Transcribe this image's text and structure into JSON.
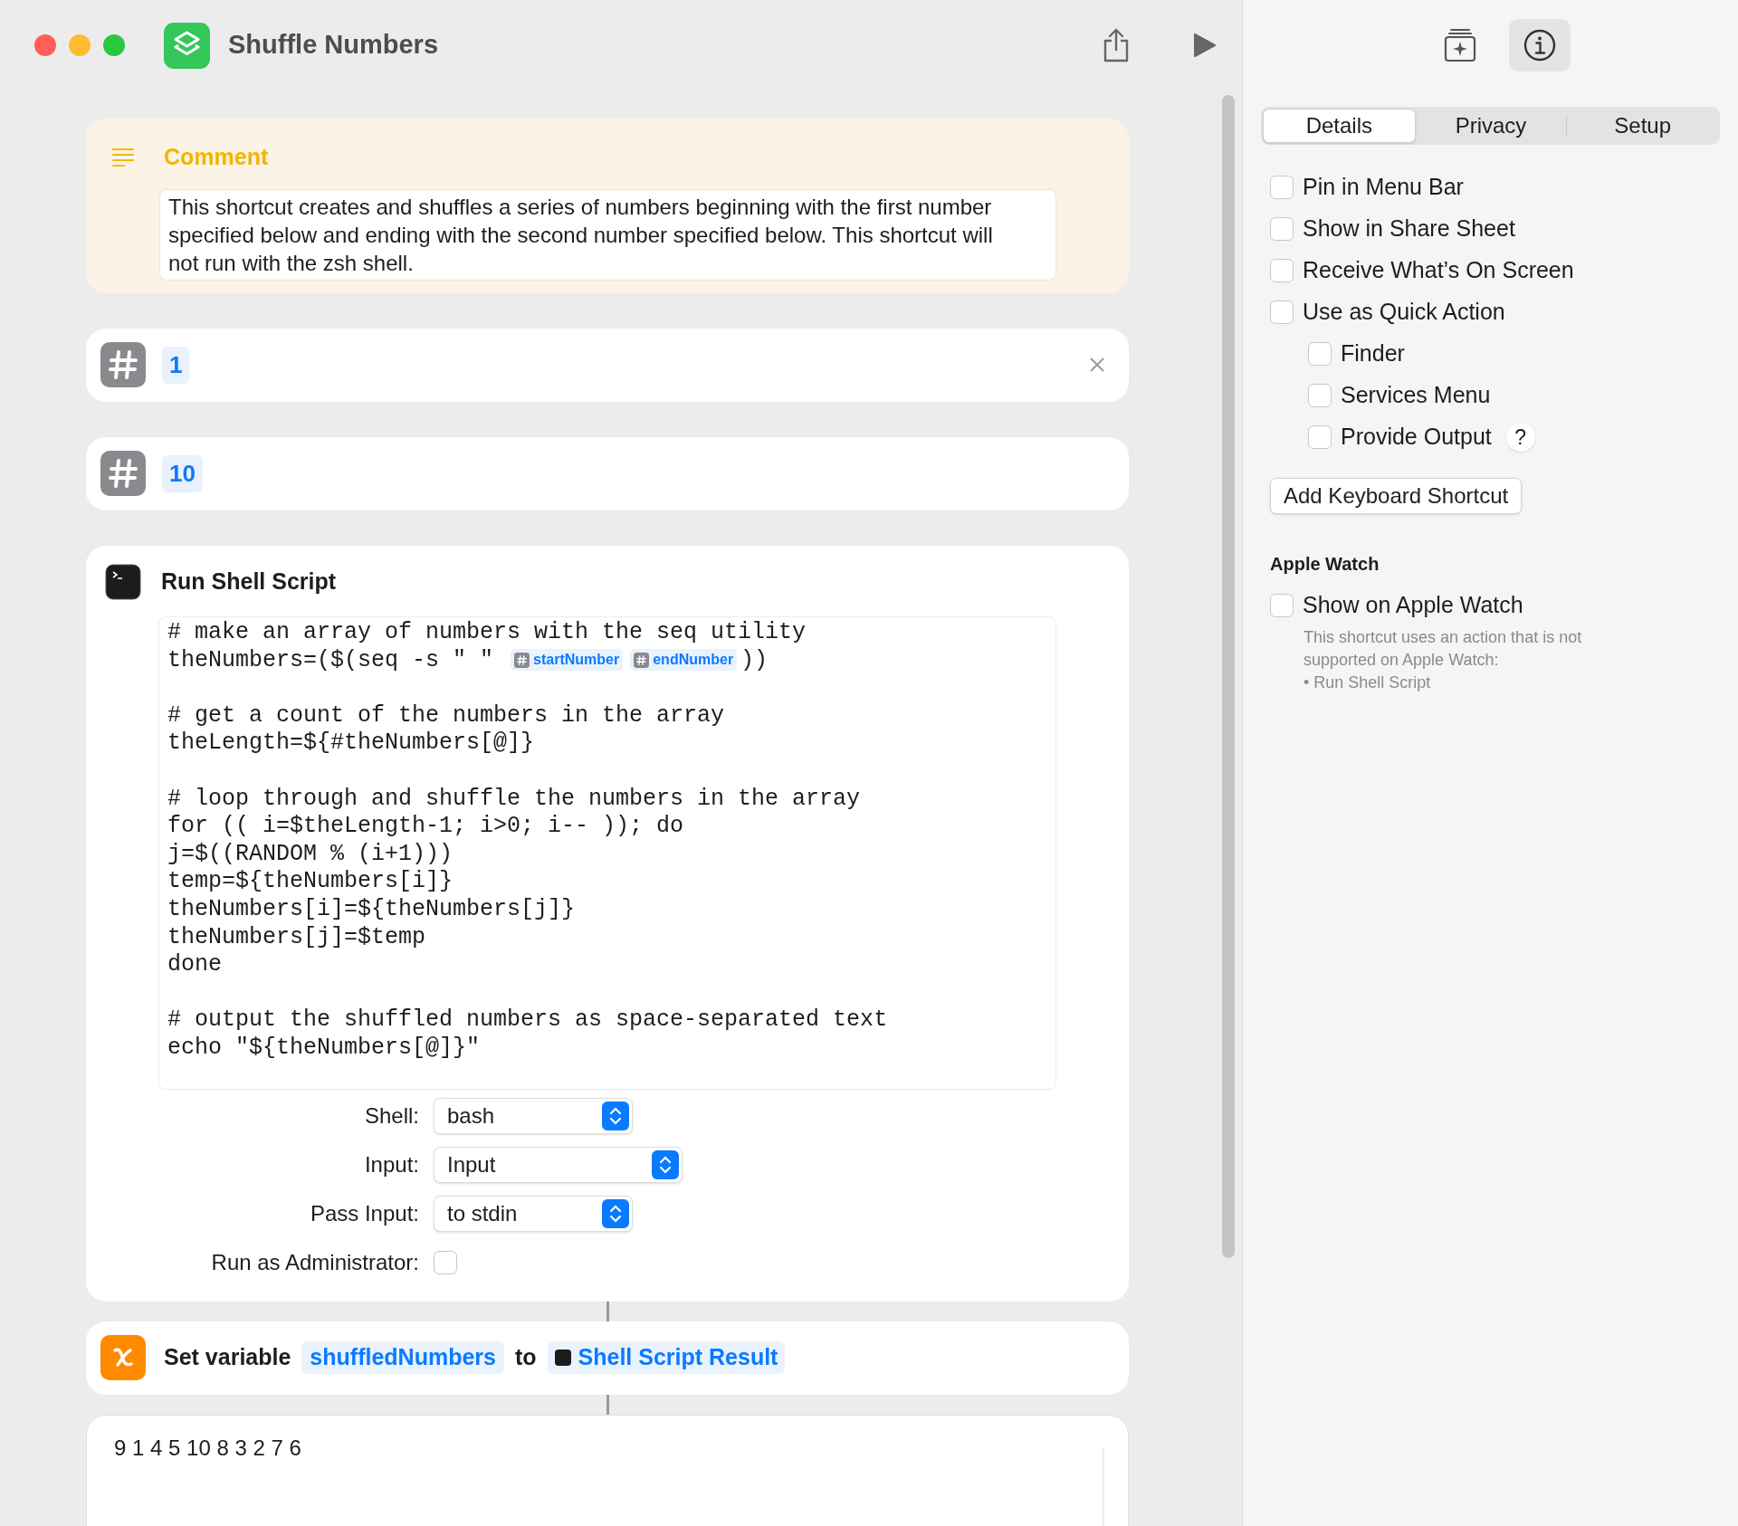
{
  "window": {
    "title": "Shuffle Numbers"
  },
  "actions": [
    {
      "kind": "comment",
      "title": "Comment",
      "text": "This shortcut creates and shuffles a series of numbers beginning with the first number specified below and ending with the second number specified below. This shortcut will not run with the zsh shell."
    },
    {
      "kind": "number",
      "value": "1",
      "removable": true
    },
    {
      "kind": "number",
      "value": "10",
      "removable": false
    },
    {
      "kind": "shell",
      "title": "Run Shell Script",
      "code_blocks": [
        [
          [
            {
              "kind": "text",
              "text": "# make an array of numbers with the seq utility"
            }
          ],
          [
            {
              "kind": "text",
              "text": "theNumbers=($(seq -s \" \" "
            },
            {
              "kind": "token",
              "text": "startNumber"
            },
            {
              "kind": "token",
              "text": "endNumber"
            },
            {
              "kind": "text",
              "text": "))"
            }
          ]
        ],
        [
          [
            {
              "kind": "text",
              "text": "# get a count of the numbers in the array"
            }
          ],
          [
            {
              "kind": "text",
              "text": "theLength=${#theNumbers[@]}"
            }
          ]
        ],
        [
          [
            {
              "kind": "text",
              "text": "# loop through and shuffle the numbers in the array"
            }
          ],
          [
            {
              "kind": "text",
              "text": "for (( i=$theLength-1; i>0; i-- )); do"
            }
          ],
          [
            {
              "kind": "text",
              "text": "j=$((RANDOM % (i+1)))"
            }
          ],
          [
            {
              "kind": "text",
              "text": "temp=${theNumbers[i]}"
            }
          ],
          [
            {
              "kind": "text",
              "text": "theNumbers[i]=${theNumbers[j]}"
            }
          ],
          [
            {
              "kind": "text",
              "text": "theNumbers[j]=$temp"
            }
          ],
          [
            {
              "kind": "text",
              "text": "done"
            }
          ]
        ],
        [
          [
            {
              "kind": "text",
              "text": "# output the shuffled numbers as space-separated text"
            }
          ],
          [
            {
              "kind": "text",
              "text": "echo \"${theNumbers[@]}\""
            }
          ]
        ]
      ],
      "options": [
        {
          "kind": "popup",
          "label": "Shell:",
          "value": "bash"
        },
        {
          "kind": "popup",
          "label": "Input:",
          "value": "Input"
        },
        {
          "kind": "popup",
          "label": "Pass Input:",
          "value": "to stdin"
        },
        {
          "kind": "checkbox",
          "label": "Run as Administrator:",
          "checked": false
        }
      ]
    },
    {
      "kind": "set_variable",
      "parts": [
        {
          "kind": "text",
          "text": "Set variable"
        },
        {
          "kind": "variable",
          "text": "shuffledNumbers"
        },
        {
          "kind": "text",
          "text": "to"
        },
        {
          "kind": "result",
          "text": "Shell Script Result"
        }
      ]
    },
    {
      "kind": "output",
      "text": "9 1 4 5 10 8 3 2 7 6"
    }
  ],
  "inspector": {
    "tabs": [
      {
        "label": "Details",
        "selected": true
      },
      {
        "label": "Privacy",
        "selected": false
      },
      {
        "label": "Setup",
        "selected": false
      }
    ],
    "options": [
      {
        "label": "Pin in Menu Bar",
        "checked": false
      },
      {
        "label": "Show in Share Sheet",
        "checked": false
      },
      {
        "label": "Receive What’s On Screen",
        "checked": false
      },
      {
        "label": "Use as Quick Action",
        "checked": false,
        "children": [
          {
            "label": "Finder",
            "checked": false
          },
          {
            "label": "Services Menu",
            "checked": false
          },
          {
            "label": "Provide Output",
            "checked": false,
            "help": "?"
          }
        ]
      }
    ],
    "button": "Add Keyboard Shortcut",
    "apple_watch": {
      "heading": "Apple Watch",
      "option": {
        "label": "Show on Apple Watch",
        "checked": false
      },
      "note": [
        "This shortcut uses an action that is not supported on Apple Watch:",
        "• Run Shell Script"
      ]
    }
  }
}
